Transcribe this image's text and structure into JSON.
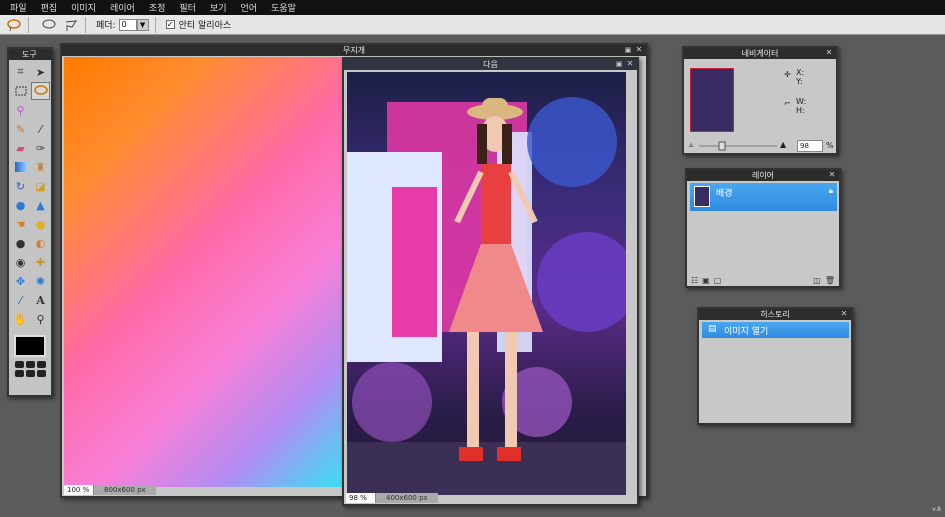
{
  "menu": [
    "파일",
    "편집",
    "이미지",
    "레이어",
    "조정",
    "필터",
    "보기",
    "언어",
    "도움말"
  ],
  "optionbar": {
    "feather_label": "페더:",
    "feather_value": "0",
    "antialias_label": "안티 알리아스",
    "antialias_checked": true
  },
  "tools_panel": {
    "title": "도구"
  },
  "doc1": {
    "title": "무지개",
    "zoom": "100 %",
    "size": "800x600 px"
  },
  "doc2": {
    "title": "다음",
    "zoom": "98 %",
    "size": "400x600 px"
  },
  "navigator": {
    "title": "네비게이터",
    "x_label": "X:",
    "y_label": "Y:",
    "w_label": "W:",
    "h_label": "H:",
    "zoom": "98",
    "percent": "%"
  },
  "layers": {
    "title": "레이어",
    "items": [
      {
        "name": "배경"
      }
    ]
  },
  "history": {
    "title": "히스토리",
    "items": [
      {
        "name": "이미지 열기"
      }
    ]
  },
  "version": "v.8",
  "colors": {
    "accent": "#2f8be0",
    "foreground": "#000000"
  }
}
